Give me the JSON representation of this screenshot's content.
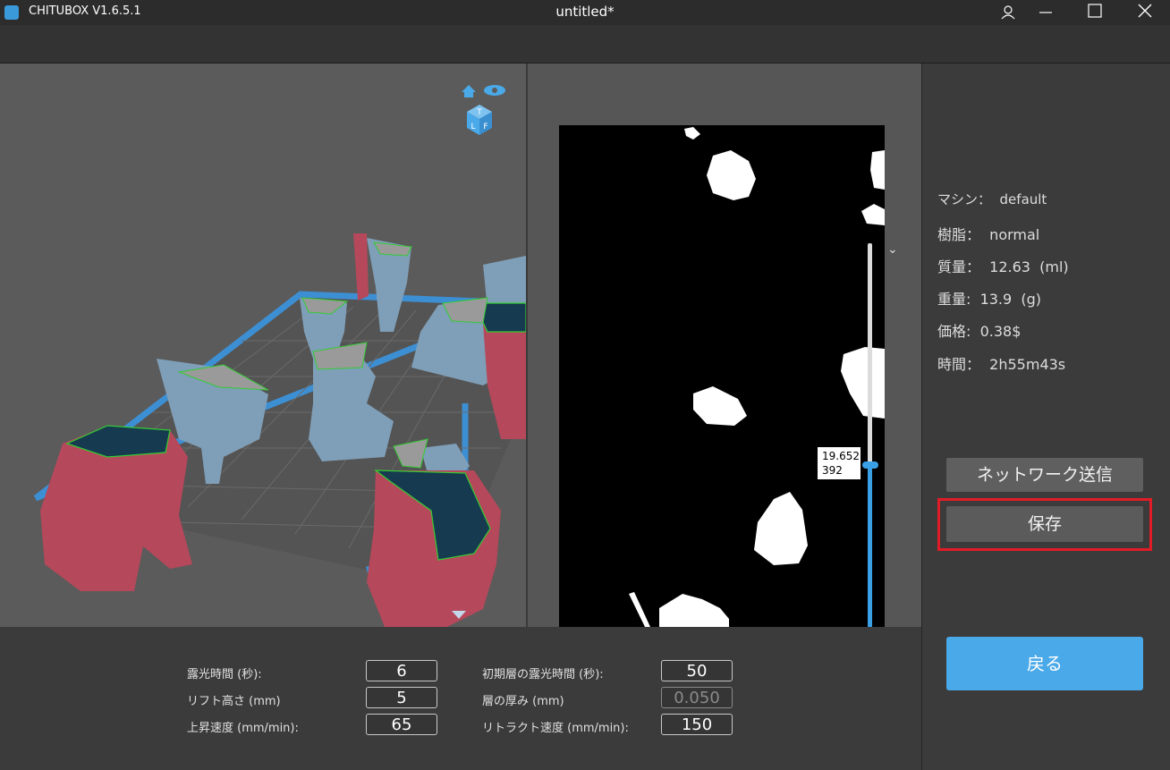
{
  "titlebar": {
    "app_name": "CHITUBOX V1.6.5.1",
    "document_title": "untitled*"
  },
  "view_cube": {
    "faces": [
      "T",
      "L",
      "F"
    ]
  },
  "slice_preview": {
    "layer_height": "19.652",
    "layer_index": "392"
  },
  "info": {
    "machine": "マシン：  default",
    "resin": "樹脂：  normal",
    "volume": "質量：  12.63  (ml)",
    "weight": "重量:  13.9  (g)",
    "price": "価格:  0.38$",
    "time": "時間：  2h55m43s"
  },
  "buttons": {
    "network_send": "ネットワーク送信",
    "save": "保存",
    "back": "戻る"
  },
  "params": {
    "exposure_time_label": "露光時間 (秒):",
    "exposure_time": "6",
    "lift_height_label": "リフト高さ (mm)",
    "lift_height": "5",
    "lift_speed_label": "上昇速度 (mm/min):",
    "lift_speed": "65",
    "bottom_exposure_label": "初期層の露光時間 (秒):",
    "bottom_exposure": "50",
    "layer_thickness_label": "層の厚み (mm)",
    "layer_thickness": "0.050",
    "retract_speed_label": "リトラクト速度 (mm/min):",
    "retract_speed": "150"
  },
  "colors": {
    "accent": "#4aa9e8",
    "highlight": "#e21c26",
    "model_blue": "#7f9fb8",
    "model_red": "#b5485a",
    "support_cut": "#163a4f"
  }
}
